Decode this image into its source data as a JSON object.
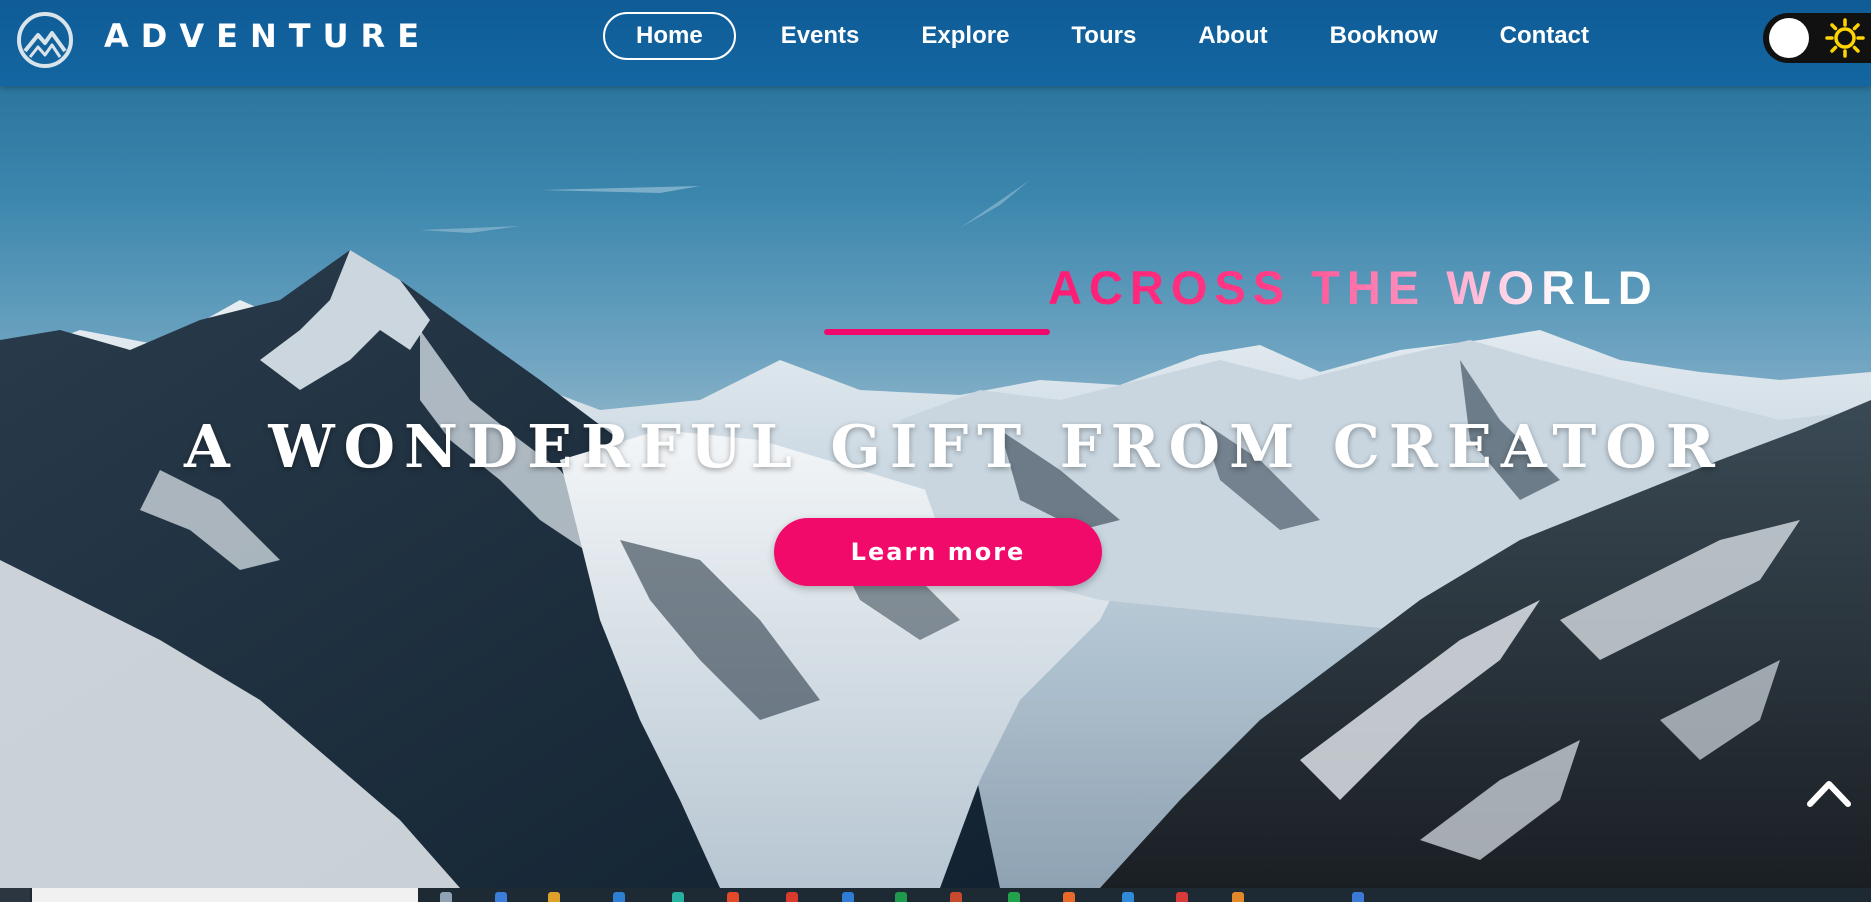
{
  "brand": {
    "name": "ADVENTURE",
    "logo_icon": "mountain-logo-icon"
  },
  "nav": {
    "items": [
      {
        "label": "Home",
        "active": true
      },
      {
        "label": "Events",
        "active": false
      },
      {
        "label": "Explore",
        "active": false
      },
      {
        "label": "Tours",
        "active": false
      },
      {
        "label": "About",
        "active": false
      },
      {
        "label": "Booknow",
        "active": false
      },
      {
        "label": "Contact",
        "active": false
      }
    ]
  },
  "theme_toggle": {
    "icon": "sun-icon",
    "mode": "light"
  },
  "hero": {
    "tagline": "ACROSS THE WORLD",
    "headline": "A WONDERFUL GIFT FROM CREATOR",
    "cta_label": "Learn more",
    "scroll_top_icon": "chevron-up-icon"
  },
  "colors": {
    "navbar": "#1366a1",
    "accent": "#f20a6b",
    "text": "#ffffff"
  }
}
